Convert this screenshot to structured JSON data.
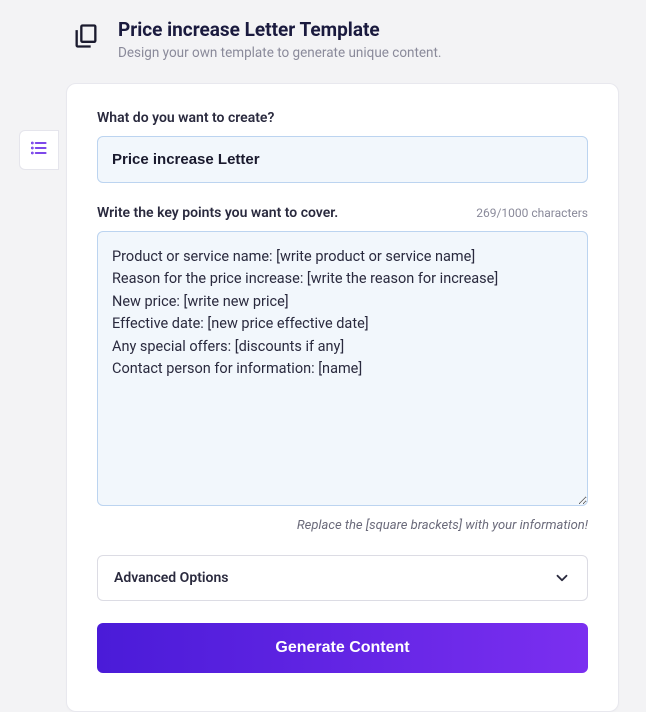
{
  "header": {
    "title": "Price increase Letter Template",
    "subtitle": "Design your own template to generate unique content."
  },
  "form": {
    "create_label": "What do you want to create?",
    "create_value": "Price increase Letter",
    "keypoints_label": "Write the key points you want to cover.",
    "keypoints_value": "Product or service name: [write product or service name]\nReason for the price increase: [write the reason for increase]\nNew price: [write new price]\nEffective date: [new price effective date]\nAny special offers: [discounts if any]\nContact person for information: [name]",
    "char_counter": "269/1000 characters",
    "hint": "Replace the [square brackets] with your information!",
    "advanced_label": "Advanced Options",
    "generate_label": "Generate Content"
  }
}
